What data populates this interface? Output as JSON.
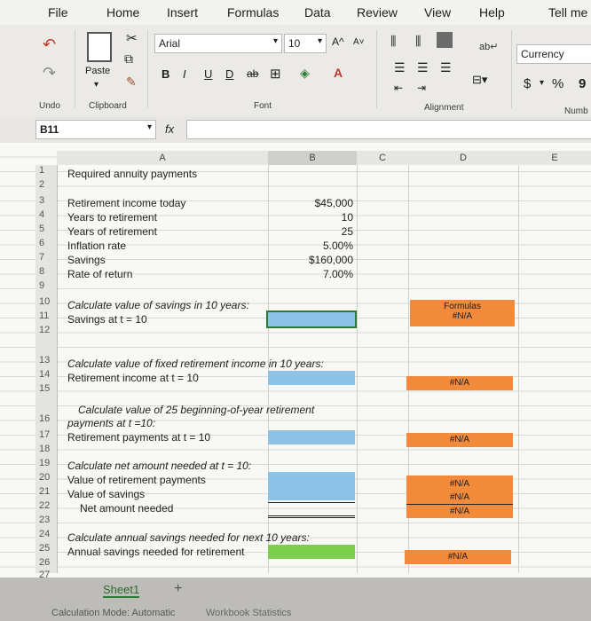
{
  "ribbon_tabs": [
    "File",
    "Home",
    "Insert",
    "Formulas",
    "Data",
    "Review",
    "View",
    "Help",
    "Tell me"
  ],
  "ribbon": {
    "font_name": "Arial",
    "font_size": "10",
    "paste_label": "Paste",
    "bold": "B",
    "italic": "I",
    "underline": "U",
    "double_underline": "D",
    "number_format": "Currency",
    "currency_symbol": "$",
    "percent_symbol": "%",
    "comma_symbol": "9",
    "group_undo": "Undo",
    "group_clipboard": "Clipboard",
    "group_font": "Font",
    "group_alignment": "Alignment",
    "group_number": "Numb",
    "grow_font": "A^",
    "shrink_font": "A˅"
  },
  "formula_bar": {
    "name_box": "B11",
    "fx": "fx",
    "formula": ""
  },
  "columns": [
    "A",
    "B",
    "C",
    "D",
    "E"
  ],
  "rows": {
    "r1": {
      "num": "1",
      "a": "Required annuity payments"
    },
    "r2": {
      "num": "2"
    },
    "r3": {
      "num": "3",
      "a": "Retirement income today",
      "b": "$45,000"
    },
    "r4": {
      "num": "4",
      "a": "Years to retirement",
      "b": "10"
    },
    "r5": {
      "num": "5",
      "a": "Years of retirement",
      "b": "25"
    },
    "r6": {
      "num": "6",
      "a": "Inflation rate",
      "b": "5.00%"
    },
    "r7": {
      "num": "7",
      "a": "Savings",
      "b": "$160,000"
    },
    "r8": {
      "num": "8",
      "a": "Rate of return",
      "b": "7.00%"
    },
    "r9": {
      "num": "9"
    },
    "r10": {
      "num": "10",
      "a": "Calculate value of savings in 10 years:",
      "d": "Formulas"
    },
    "r11": {
      "num": "11",
      "a": "Savings at t = 10",
      "d": "#N/A"
    },
    "r12": {
      "num": "12"
    },
    "r13": {
      "num": "13",
      "a": "Calculate value of fixed retirement income in 10 years:"
    },
    "r14": {
      "num": "14",
      "a": "Retirement income at t = 10",
      "d": "#N/A"
    },
    "r15": {
      "num": "15",
      "a": "Calculate value of 25 beginning-of-year retirement"
    },
    "r16": {
      "num": "16",
      "a": "payments at t =10:"
    },
    "r17": {
      "num": "17",
      "a": "Retirement payments at t = 10",
      "d": "#N/A"
    },
    "r18": {
      "num": "18"
    },
    "r19": {
      "num": "19",
      "a": "Calculate net amount needed at t = 10:"
    },
    "r20": {
      "num": "20",
      "a": "Value of retirement payments",
      "d": "#N/A"
    },
    "r21": {
      "num": "21",
      "a": "Value of savings",
      "d": "#N/A"
    },
    "r22": {
      "num": "22",
      "a": "Net amount needed",
      "d": "#N/A"
    },
    "r23": {
      "num": "23"
    },
    "r24": {
      "num": "24",
      "a": "Calculate annual savings needed for next 10 years:"
    },
    "r25": {
      "num": "25",
      "a": "Annual savings needed for retirement",
      "d": "#N/A"
    },
    "r26": {
      "num": "26"
    },
    "r27": {
      "num": "27"
    }
  },
  "sheet_tab": "Sheet1",
  "add_sheet": "+",
  "status": "Calculation Mode: Automatic",
  "status2": "Workbook Statistics",
  "colors": {
    "input_blue": "#8ec3e8",
    "answer_green": "#7fcf4f",
    "formula_orange": "#f28a3c"
  }
}
